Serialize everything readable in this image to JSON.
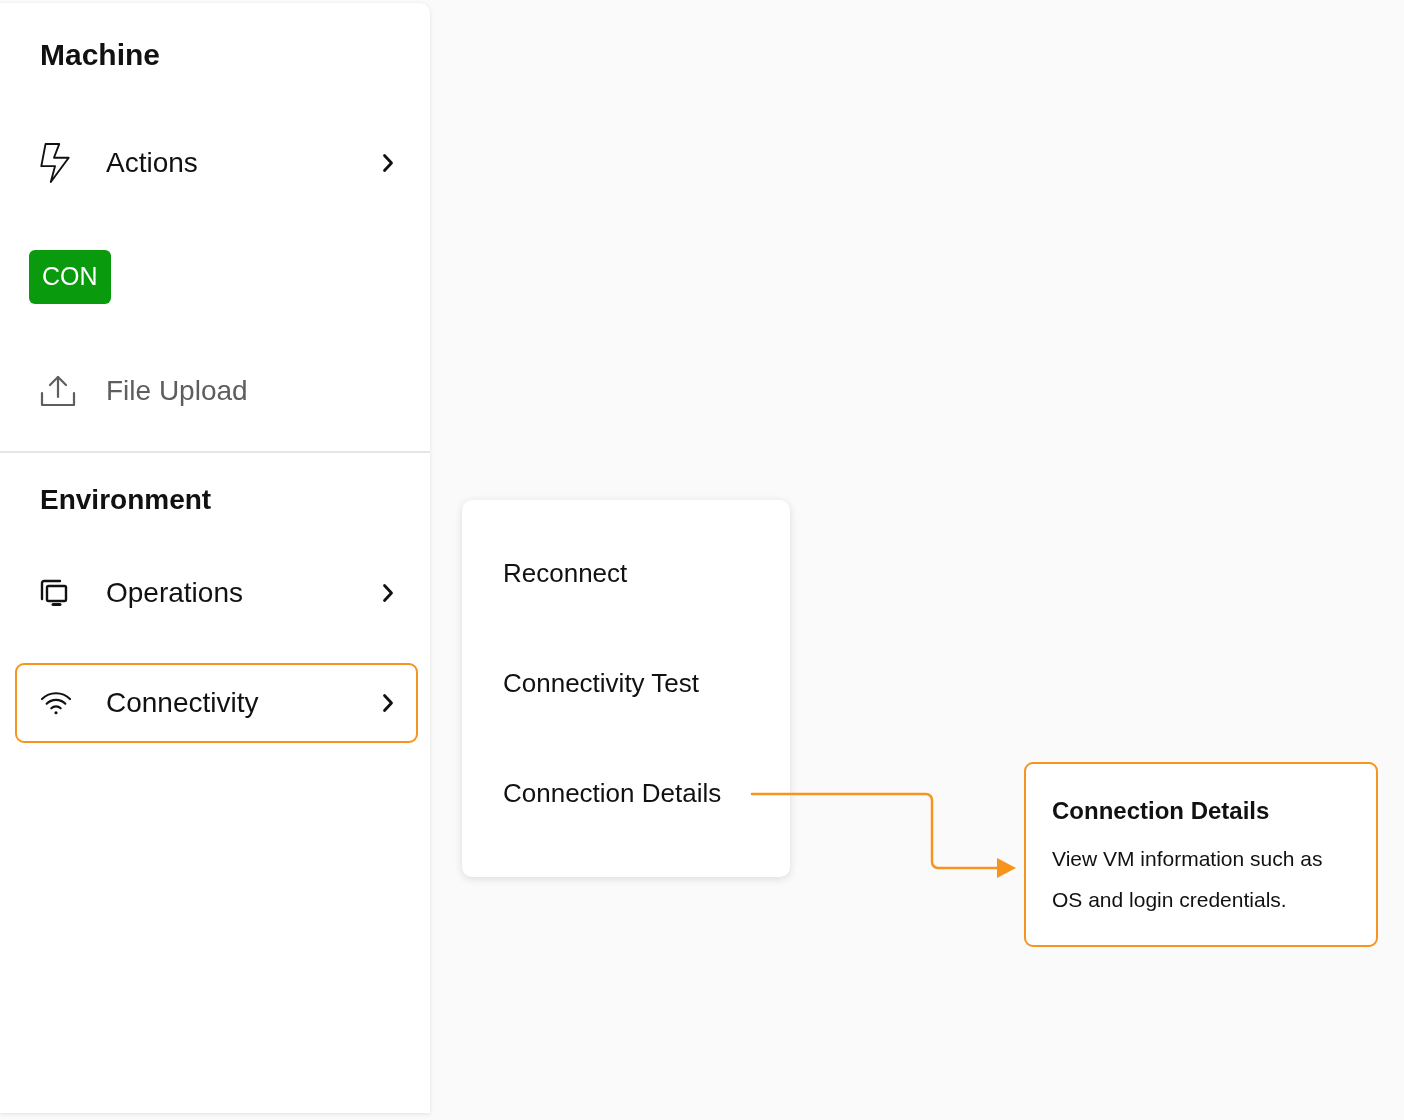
{
  "sidebar": {
    "sections": [
      {
        "title": "Machine",
        "items": [
          {
            "kind": "submenu",
            "label": "Actions",
            "selected": false,
            "disabled": false
          },
          {
            "kind": "badge",
            "label": "CON",
            "selected": false,
            "disabled": false
          },
          {
            "kind": "action",
            "label": "File Upload",
            "selected": false,
            "disabled": true
          }
        ]
      },
      {
        "title": "Environment",
        "items": [
          {
            "kind": "submenu",
            "label": "Operations",
            "selected": false,
            "disabled": false
          },
          {
            "kind": "submenu",
            "label": "Connectivity",
            "selected": true,
            "disabled": false
          }
        ]
      }
    ]
  },
  "submenu": {
    "items": [
      {
        "label": "Reconnect"
      },
      {
        "label": "Connectivity Test"
      },
      {
        "label": "Connection Details"
      }
    ]
  },
  "callout": {
    "title": "Connection Details",
    "text": "View VM information such as OS and login credentials."
  }
}
